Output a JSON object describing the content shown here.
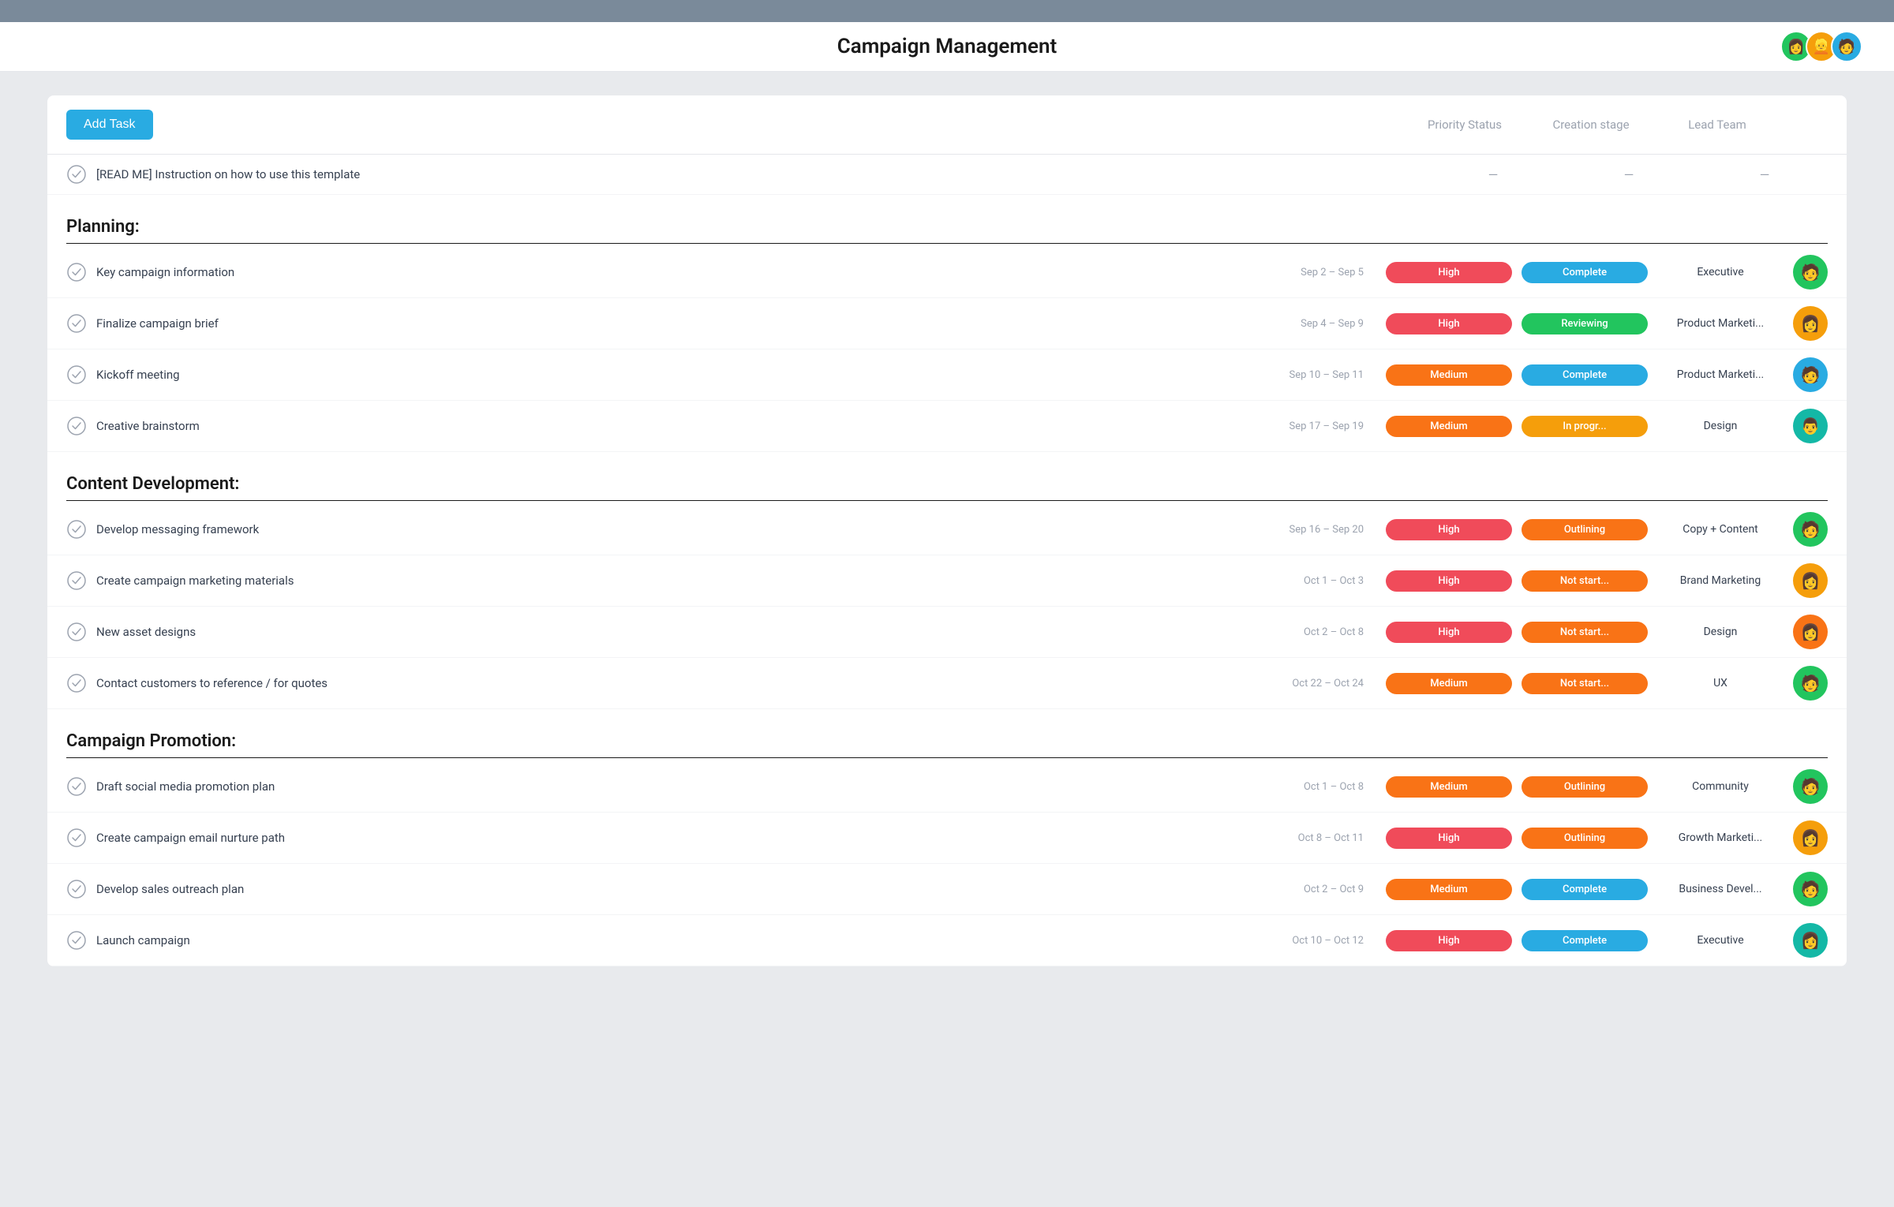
{
  "topbar": {},
  "header": {
    "title": "Campaign Management",
    "avatars": [
      {
        "emoji": "👩",
        "color": "#22c55e"
      },
      {
        "emoji": "👱",
        "color": "#f59e0b"
      },
      {
        "emoji": "🧑",
        "color": "#29abe2"
      }
    ]
  },
  "toolbar": {
    "add_task_label": "Add Task",
    "col_priority": "Priority Status",
    "col_creation": "Creation stage",
    "col_team": "Lead Team"
  },
  "info_row": {
    "text": "[READ ME] Instruction on how to use this template"
  },
  "sections": [
    {
      "title": "Planning:",
      "tasks": [
        {
          "name": "Key campaign information",
          "date": "Sep 2 – Sep 5",
          "priority": "High",
          "priority_class": "badge-high",
          "status": "Complete",
          "status_class": "badge-complete",
          "team": "Executive",
          "avatar_emoji": "🧑",
          "avatar_class": "av-green"
        },
        {
          "name": "Finalize campaign brief",
          "date": "Sep 4 – Sep 9",
          "priority": "High",
          "priority_class": "badge-high",
          "status": "Reviewing",
          "status_class": "badge-reviewing",
          "team": "Product Marketi...",
          "avatar_emoji": "👩",
          "avatar_class": "av-yellow"
        },
        {
          "name": "Kickoff meeting",
          "date": "Sep 10 – Sep 11",
          "priority": "Medium",
          "priority_class": "badge-medium",
          "status": "Complete",
          "status_class": "badge-complete",
          "team": "Product Marketi...",
          "avatar_emoji": "🧑",
          "avatar_class": "av-blue"
        },
        {
          "name": "Creative brainstorm",
          "date": "Sep 17 – Sep 19",
          "priority": "Medium",
          "priority_class": "badge-medium",
          "status": "In progr...",
          "status_class": "badge-inprogress",
          "team": "Design",
          "avatar_emoji": "👨",
          "avatar_class": "av-teal"
        }
      ]
    },
    {
      "title": "Content Development:",
      "tasks": [
        {
          "name": "Develop messaging framework",
          "date": "Sep 16 – Sep 20",
          "priority": "High",
          "priority_class": "badge-high",
          "status": "Outlining",
          "status_class": "badge-outlining",
          "team": "Copy + Content",
          "avatar_emoji": "🧑",
          "avatar_class": "av-green"
        },
        {
          "name": "Create campaign marketing materials",
          "date": "Oct 1 – Oct 3",
          "priority": "High",
          "priority_class": "badge-high",
          "status": "Not start...",
          "status_class": "badge-notstart",
          "team": "Brand Marketing",
          "avatar_emoji": "👩",
          "avatar_class": "av-yellow"
        },
        {
          "name": "New asset designs",
          "date": "Oct 2 – Oct 8",
          "priority": "High",
          "priority_class": "badge-high",
          "status": "Not start...",
          "status_class": "badge-notstart",
          "team": "Design",
          "avatar_emoji": "👩",
          "avatar_class": "av-orange"
        },
        {
          "name": "Contact customers to reference / for quotes",
          "date": "Oct 22 – Oct 24",
          "priority": "Medium",
          "priority_class": "badge-medium",
          "status": "Not start...",
          "status_class": "badge-notstart",
          "team": "UX",
          "avatar_emoji": "🧑",
          "avatar_class": "av-green"
        }
      ]
    },
    {
      "title": "Campaign Promotion:",
      "tasks": [
        {
          "name": "Draft social media promotion plan",
          "date": "Oct 1 – Oct 8",
          "priority": "Medium",
          "priority_class": "badge-medium",
          "status": "Outlining",
          "status_class": "badge-outlining",
          "team": "Community",
          "avatar_emoji": "🧑",
          "avatar_class": "av-green"
        },
        {
          "name": "Create campaign email nurture path",
          "date": "Oct 8 – Oct 11",
          "priority": "High",
          "priority_class": "badge-high",
          "status": "Outlining",
          "status_class": "badge-outlining",
          "team": "Growth Marketi...",
          "avatar_emoji": "👩",
          "avatar_class": "av-yellow"
        },
        {
          "name": "Develop sales outreach plan",
          "date": "Oct 2 – Oct 9",
          "priority": "Medium",
          "priority_class": "badge-medium",
          "status": "Complete",
          "status_class": "badge-complete",
          "team": "Business Devel...",
          "avatar_emoji": "🧑",
          "avatar_class": "av-green"
        },
        {
          "name": "Launch campaign",
          "date": "Oct 10 – Oct 12",
          "priority": "High",
          "priority_class": "badge-high",
          "status": "Complete",
          "status_class": "badge-complete",
          "team": "Executive",
          "avatar_emoji": "👩",
          "avatar_class": "av-teal"
        }
      ]
    }
  ]
}
